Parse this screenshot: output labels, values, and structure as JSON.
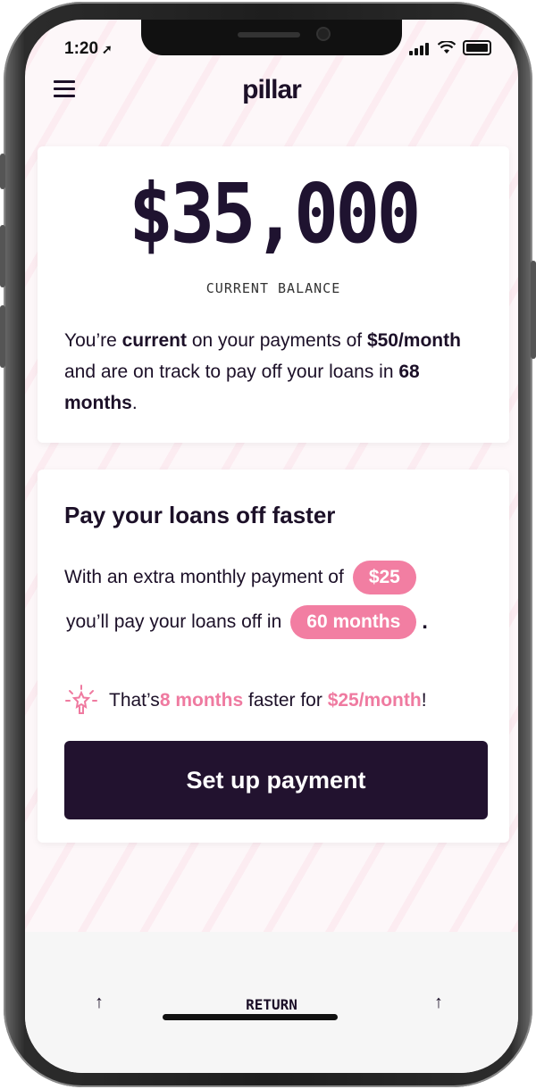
{
  "status_bar": {
    "time": "1:20"
  },
  "header": {
    "logo": "pillar"
  },
  "balance_card": {
    "amount": "$35,000",
    "label": "CURRENT BALANCE",
    "summary": {
      "t1": "You’re ",
      "b1": "current",
      "t2": " on your payments of ",
      "b2": "$50/month",
      "t3": " and are on track to pay off your loans in ",
      "b3": "68 months",
      "t4": "."
    }
  },
  "payoff_card": {
    "title": "Pay your loans off faster",
    "line1_text": "With an extra monthly payment of",
    "extra_payment": "$25",
    "line2_text": "you’ll pay your loans off in",
    "months": "60 months",
    "line2_end": ".",
    "savings": {
      "prefix": "That’s ",
      "months_faster": "8 months",
      "middle": " faster for ",
      "amount": "$25/month",
      "suffix": "!"
    },
    "cta_label": "Set up payment"
  },
  "bottom_bar": {
    "left_arrow": "↑",
    "label": "RETURN",
    "right_arrow": "↑"
  },
  "colors": {
    "brand_dark": "#22122f",
    "accent_pink": "#f27ea2"
  }
}
